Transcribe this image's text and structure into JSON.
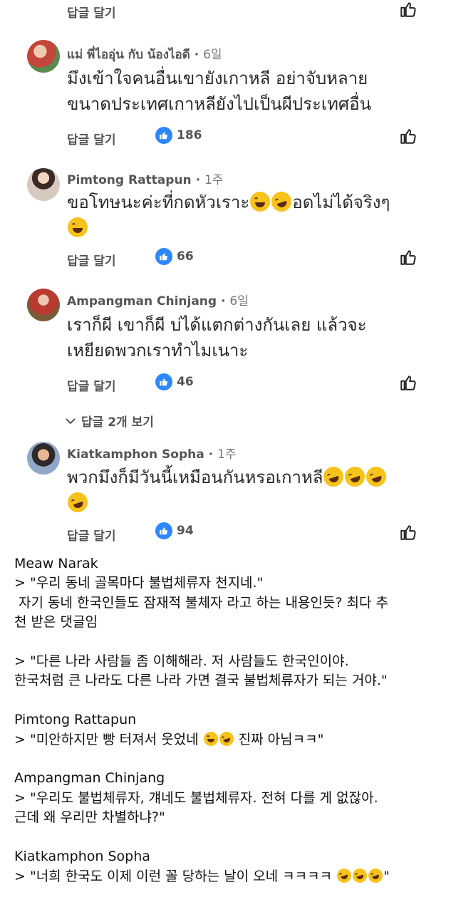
{
  "ui": {
    "reply_label": "답글 달기",
    "more_replies_label": "답글 2개 보기"
  },
  "comments": [
    {
      "author": "แม่ พี่ไออุ่น กับ น้องไอดี",
      "time": "6일",
      "line1": "มึงเข้าใจคนอื่นเขายังเกาหลี อย่าจับหลาย",
      "line2": "ขนาดประเทศเกาหลียังไปเป็นผีประเทศอื่น",
      "likes": "186"
    },
    {
      "author": "Pimtong Rattapun",
      "time": "1주",
      "line1": "ขอโทษนะค่ะที่กดหัวเราะ",
      "line1_end": "อดไม่ได้จริงๆ",
      "likes": "66"
    },
    {
      "author": "Ampangman Chinjang",
      "time": "6일",
      "line1": "เราก็ผี เขาก็ผี บ่ได้แตกต่างกันเลย แล้วจะ",
      "line2": "เหยียดพวกเราทำไมเนาะ",
      "likes": "46"
    },
    {
      "author": "Kiatkamphon Sopha",
      "time": "1주",
      "line1": "พวกมึงก็มีวันนี้เหมือนกันหรอเกาหลี",
      "likes": "94"
    }
  ],
  "caption": {
    "c1_name": "Meaw Narak",
    "c1_q1": "> \"우리 동네 골목마다 불법체류자 천지네.\"",
    "c1_note1": " 자기 동네 한국인들도 잠재적 불체자 라고 하는 내용인듯? 최다 추",
    "c1_note2": "천 받은 댓글임",
    "c1_q2a": "> \"다른 나라 사람들 좀 이해해라. 저 사람들도 한국인이야.",
    "c1_q2b": "한국처럼 큰 나라도 다른 나라 가면 결국 불법체류자가 되는 거야.\"",
    "c2_name": "Pimtong Rattapun",
    "c2_q_a": "> \"미안하지만 빵 터져서 웃었네 ",
    "c2_q_b": " 진짜 아님ㅋㅋ\"",
    "c3_name": "Ampangman Chinjang",
    "c3_qa": "> \"우리도 불법체류자, 걔네도 불법체류자. 전혀 다를 게 없잖아.",
    "c3_qb": "근데 왜 우리만 차별하냐?\"",
    "c4_name": "Kiatkamphon Sopha",
    "c4_q": "> \"너희 한국도 이제 이런 꼴 당하는 날이 오네 ㅋㅋㅋㅋ ",
    "c4_q_end": "\""
  }
}
